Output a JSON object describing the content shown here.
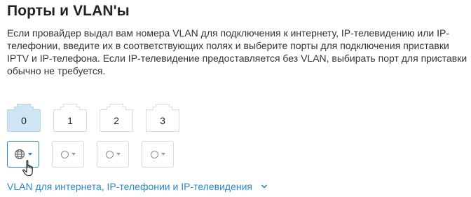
{
  "section": {
    "title": "Порты и VLAN'ы",
    "description": "Если провайдер выдал вам номера VLAN для подключения к интернету, IP-телевидению или IP-телефонии, введите их в соответствующих полях и выберите порты для подключения приставки IPTV и IP-телефона. Если IP-телевидение предоставляется без VLAN, выбирать порт для приставки обычно не требуется."
  },
  "ports": [
    {
      "label": "0",
      "selected": true
    },
    {
      "label": "1",
      "selected": false
    },
    {
      "label": "2",
      "selected": false
    },
    {
      "label": "3",
      "selected": false
    }
  ],
  "port_assignments": [
    {
      "icon": "globe-icon",
      "active": true
    },
    {
      "icon": "circle-icon",
      "active": false
    },
    {
      "icon": "circle-icon",
      "active": false
    },
    {
      "icon": "circle-icon",
      "active": false
    }
  ],
  "vlan_link": {
    "label": "VLAN для интернета, IP-телефонии и IP-телевидения"
  },
  "colors": {
    "accent": "#2a8ac7",
    "port_selected_fill": "#cfe5f3",
    "port_outline": "#dcdcdc"
  }
}
